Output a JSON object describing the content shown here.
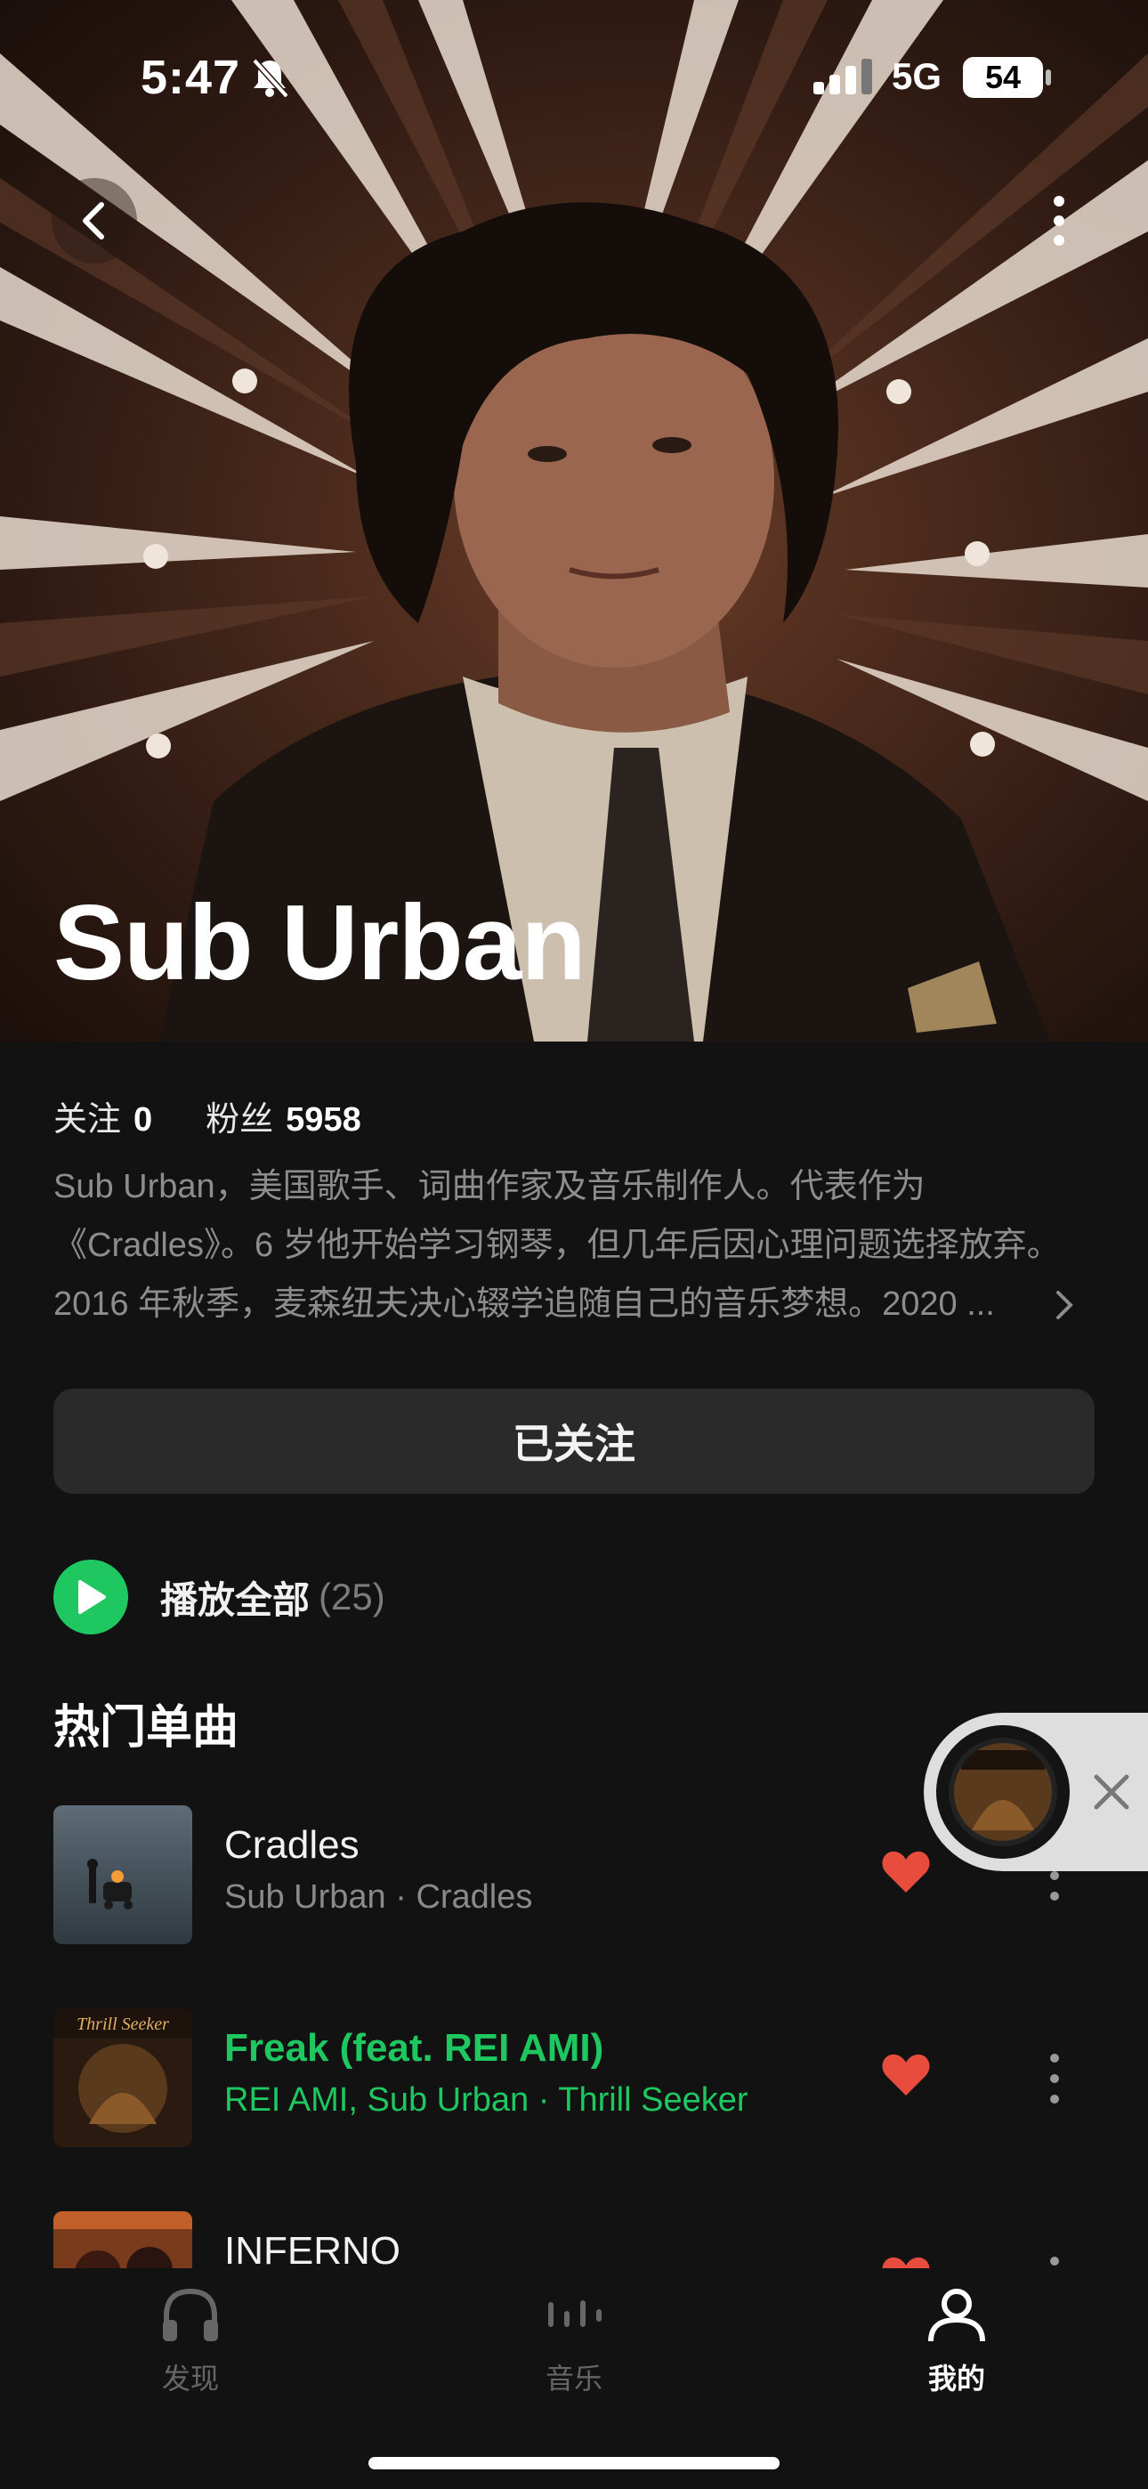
{
  "status_bar": {
    "time": "5:47",
    "network": "5G",
    "battery": "54"
  },
  "artist": {
    "name": "Sub Urban",
    "following_label": "关注",
    "following_count": "0",
    "fans_label": "粉丝",
    "fans_count": "5958",
    "bio_lines": [
      "Sub Urban，美国歌手、词曲作家及音乐制作人。代表作为",
      "《Cradles》。6 岁他开始学习钢琴，但几年后因心理问题选择放弃。",
      "2016 年秋季，麦森纽夫决心辍学追随自己的音乐梦想。2020 ..."
    ],
    "follow_button": "已关注"
  },
  "play_all": {
    "label": "播放全部",
    "count": "(25)"
  },
  "hot_songs": {
    "title": "热门单曲",
    "items": [
      {
        "title": "Cradles",
        "subtitle": "Sub Urban · Cradles",
        "active": false
      },
      {
        "title": "Freak (feat. REI AMI)",
        "subtitle": "REI AMI, Sub Urban · Thrill Seeker",
        "active": true,
        "cover_text": "Thrill Seeker"
      },
      {
        "title": "INFERNO",
        "subtitle": "",
        "active": false
      }
    ]
  },
  "tabs": [
    {
      "label": "发现",
      "icon": "headphones-icon",
      "active": false
    },
    {
      "label": "音乐",
      "icon": "equalizer-icon",
      "active": false
    },
    {
      "label": "我的",
      "icon": "profile-icon",
      "active": true
    }
  ],
  "colors": {
    "accent": "#1ec760",
    "heart": "#e74c3c",
    "background": "#121212"
  }
}
